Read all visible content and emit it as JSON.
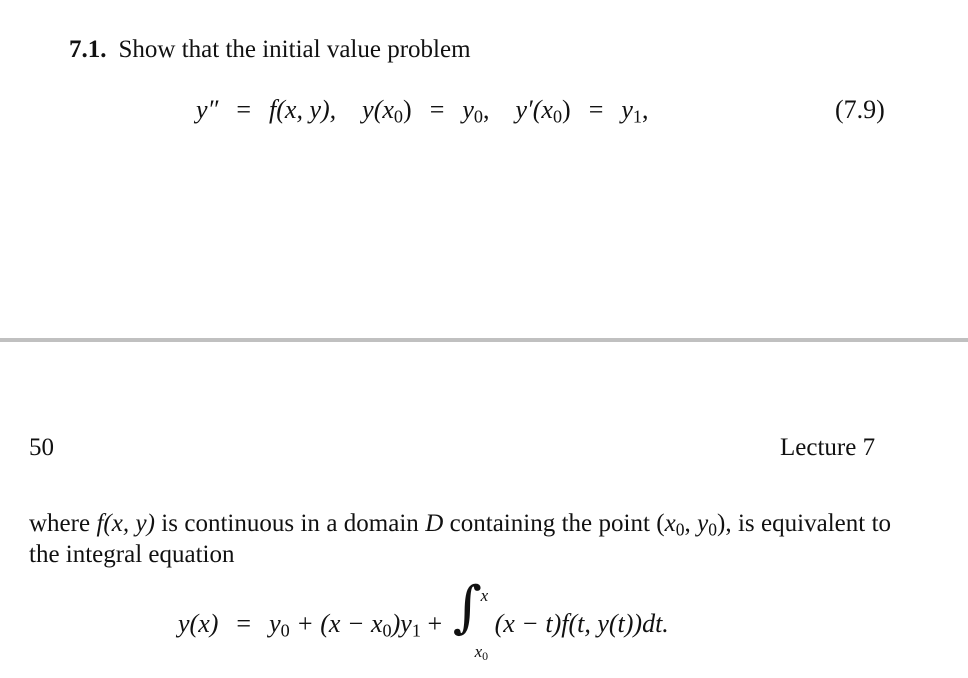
{
  "exercise": {
    "number": "7.1.",
    "text": "Show that the initial value problem"
  },
  "equation_7_9": {
    "lhs1": "y″",
    "eq": "=",
    "rhs1": "f(x, y),",
    "lhs2_y": "y(x",
    "lhs2_sub": "0",
    "lhs2_close": ")",
    "rhs2_y": "y",
    "rhs2_sub": "0",
    "rhs2_comma": ",",
    "lhs3_y": "y′(x",
    "lhs3_sub": "0",
    "lhs3_close": ")",
    "rhs3_y": "y",
    "rhs3_sub": "1",
    "rhs3_comma": ",",
    "label": "(7.9)"
  },
  "page": {
    "number": "50",
    "running_header": "Lecture 7"
  },
  "paragraph": {
    "t1": "where ",
    "m1": "f(x, y)",
    "t2": " is continuous in a domain ",
    "m2": "D",
    "t3": " containing the point (",
    "m3a": "x",
    "m3a_sub": "0",
    "m3sep": ", ",
    "m3b": "y",
    "m3b_sub": "0",
    "t4": "), is equivalent to the integral equation"
  },
  "integral_equation": {
    "lhs": "y(x)",
    "eq": "=",
    "term1": "y",
    "term1_sub": "0",
    "plus1": " + (x − x",
    "term2_sub": "0",
    "term2_close": ")y",
    "term2_ysub": "1",
    "plus2": " +",
    "integral_symbol": "∫",
    "upper_limit": "x",
    "lower_limit": "x",
    "lower_limit_sub": "0",
    "integrand": "(x − t)f(t, y(t))dt."
  }
}
